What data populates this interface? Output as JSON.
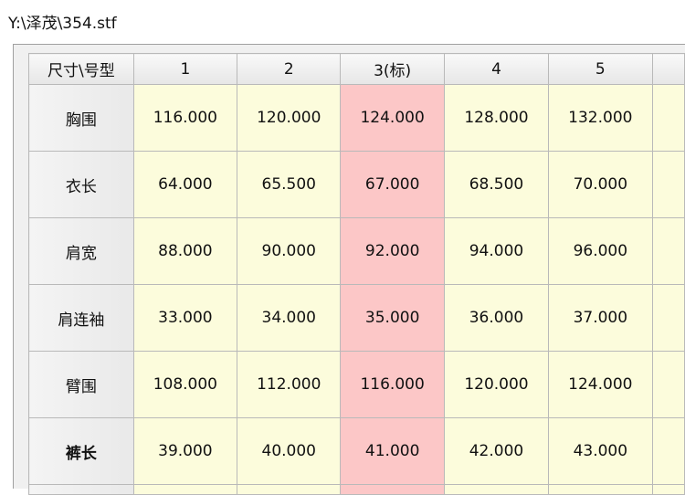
{
  "window": {
    "title": "Y:\\泽茂\\354.stf"
  },
  "table": {
    "corner_label": "尺寸\\号型",
    "columns": [
      "1",
      "2",
      "3(标)",
      "4",
      "5"
    ],
    "standard_column_index": 2,
    "rows": [
      {
        "label": "胸围",
        "bold": false,
        "values": [
          "116.000",
          "120.000",
          "124.000",
          "128.000",
          "132.000"
        ]
      },
      {
        "label": "衣长",
        "bold": false,
        "values": [
          "64.000",
          "65.500",
          "67.000",
          "68.500",
          "70.000"
        ]
      },
      {
        "label": "肩宽",
        "bold": false,
        "values": [
          "88.000",
          "90.000",
          "92.000",
          "94.000",
          "96.000"
        ]
      },
      {
        "label": "肩连袖",
        "bold": false,
        "values": [
          "33.000",
          "34.000",
          "35.000",
          "36.000",
          "37.000"
        ]
      },
      {
        "label": "臂围",
        "bold": false,
        "values": [
          "108.000",
          "112.000",
          "116.000",
          "120.000",
          "124.000"
        ]
      },
      {
        "label": "裤长",
        "bold": true,
        "values": [
          "39.000",
          "40.000",
          "41.000",
          "42.000",
          "43.000"
        ]
      }
    ]
  },
  "colors": {
    "cell_background": "#fcfcdc",
    "standard_column_background": "#fcc7c7",
    "header_background": "#ebebeb"
  }
}
